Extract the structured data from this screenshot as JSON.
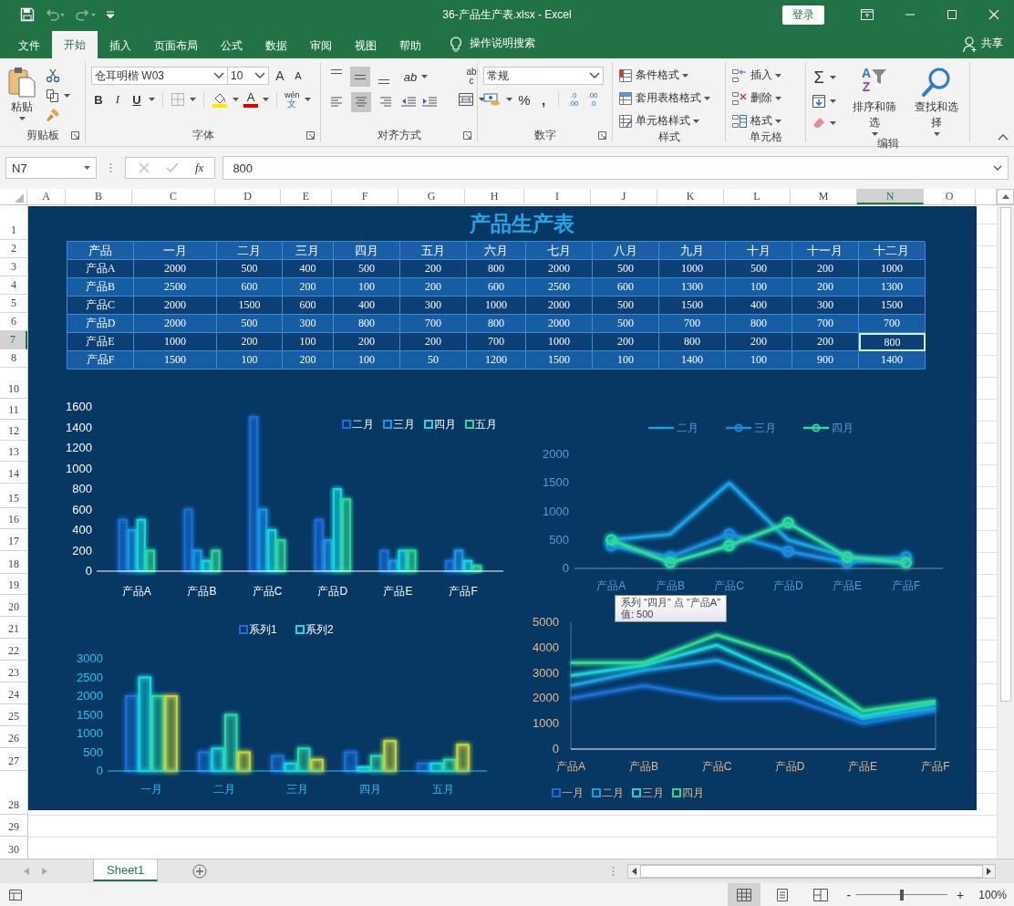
{
  "window": {
    "title": "36-产品生产表.xlsx  -  Excel",
    "sign_in": "登录"
  },
  "ribbon_tabs": [
    {
      "label": "文件",
      "selected": false
    },
    {
      "label": "开始",
      "selected": true
    },
    {
      "label": "插入",
      "selected": false
    },
    {
      "label": "页面布局",
      "selected": false
    },
    {
      "label": "公式",
      "selected": false
    },
    {
      "label": "数据",
      "selected": false
    },
    {
      "label": "审阅",
      "selected": false
    },
    {
      "label": "视图",
      "selected": false
    },
    {
      "label": "帮助",
      "selected": false
    }
  ],
  "tell_me": "操作说明搜索",
  "share": "共享",
  "ribbon": {
    "clipboard": {
      "paste": "粘贴",
      "label": "剪贴板"
    },
    "font": {
      "name": "仓耳明楷 W03",
      "size": "10",
      "grow": "A",
      "shrink": "A",
      "bold": "B",
      "italic": "I",
      "underline": "U",
      "font_color": "A",
      "phonetic": [
        "wén",
        "文"
      ],
      "label": "字体"
    },
    "alignment": {
      "vertical": [
        {
          "kind": "top",
          "selected": false
        },
        {
          "kind": "middle",
          "selected": true
        },
        {
          "kind": "bottom",
          "selected": false
        }
      ],
      "orientation": "ab",
      "wrap": [
        "ab",
        "c"
      ],
      "horizontal": [
        {
          "kind": "left",
          "selected": false
        },
        {
          "kind": "center",
          "selected": true
        },
        {
          "kind": "right",
          "selected": false
        }
      ],
      "label": "对齐方式"
    },
    "number": {
      "format": "常规",
      "percent": "%",
      "comma": ",",
      "increase_decimal": [
        ".0",
        ".00"
      ],
      "decrease_decimal": [
        ".00",
        ".0"
      ],
      "label": "数字"
    },
    "styles": {
      "items": [
        {
          "kind": "conditional",
          "label": "条件格式"
        },
        {
          "kind": "table",
          "label": "套用表格格式"
        },
        {
          "kind": "cell",
          "label": "单元格样式"
        }
      ],
      "label": "样式"
    },
    "cells": {
      "items": [
        {
          "kind": "insert",
          "label": "插入"
        },
        {
          "kind": "delete",
          "label": "删除"
        },
        {
          "kind": "format",
          "label": "格式"
        }
      ],
      "label": "单元格"
    },
    "editing": {
      "sum": "Σ",
      "sort": {
        "label": "排序和筛选",
        "letters": [
          "A",
          "Z"
        ]
      },
      "find": "查找和选择",
      "label": "编辑"
    }
  },
  "formula_bar": {
    "name_box": "N7",
    "fx": "fx",
    "value": "800"
  },
  "columns": [
    {
      "label": "A",
      "selected": false
    },
    {
      "label": "B",
      "selected": false
    },
    {
      "label": "C",
      "selected": false
    },
    {
      "label": "D",
      "selected": false
    },
    {
      "label": "E",
      "selected": false
    },
    {
      "label": "F",
      "selected": false
    },
    {
      "label": "G",
      "selected": false
    },
    {
      "label": "H",
      "selected": false
    },
    {
      "label": "I",
      "selected": false
    },
    {
      "label": "J",
      "selected": false
    },
    {
      "label": "K",
      "selected": false
    },
    {
      "label": "L",
      "selected": false
    },
    {
      "label": "M",
      "selected": false
    },
    {
      "label": "N",
      "selected": true
    },
    {
      "label": "O",
      "selected": false
    }
  ],
  "rows": [
    {
      "label": "1",
      "selected": false
    },
    {
      "label": "2",
      "selected": false
    },
    {
      "label": "3",
      "selected": false
    },
    {
      "label": "4",
      "selected": false
    },
    {
      "label": "5",
      "selected": false
    },
    {
      "label": "6",
      "selected": false
    },
    {
      "label": "7",
      "selected": true
    },
    {
      "label": "8",
      "selected": false
    },
    {
      "label": "10",
      "selected": false
    },
    {
      "label": "11",
      "selected": false
    },
    {
      "label": "12",
      "selected": false
    },
    {
      "label": "13",
      "selected": false
    },
    {
      "label": "14",
      "selected": false
    },
    {
      "label": "15",
      "selected": false
    },
    {
      "label": "16",
      "selected": false
    },
    {
      "label": "17",
      "selected": false
    },
    {
      "label": "18",
      "selected": false
    },
    {
      "label": "19",
      "selected": false
    },
    {
      "label": "20",
      "selected": false
    },
    {
      "label": "21",
      "selected": false
    },
    {
      "label": "22",
      "selected": false
    },
    {
      "label": "23",
      "selected": false
    },
    {
      "label": "24",
      "selected": false
    },
    {
      "label": "25",
      "selected": false
    },
    {
      "label": "26",
      "selected": false
    },
    {
      "label": "27",
      "selected": false
    },
    {
      "label": "28",
      "selected": false
    },
    {
      "label": "29",
      "selected": false
    },
    {
      "label": "30",
      "selected": false
    }
  ],
  "sheet": {
    "title": "产品生产表",
    "table": {
      "header": [
        "产品",
        "一月",
        "二月",
        "三月",
        "四月",
        "五月",
        "六月",
        "七月",
        "八月",
        "九月",
        "十月",
        "十一月",
        "十二月"
      ],
      "rows": [
        {
          "cells": [
            {
              "text": "产品A",
              "selected": false
            },
            {
              "text": "2000",
              "selected": false
            },
            {
              "text": "500",
              "selected": false
            },
            {
              "text": "400",
              "selected": false
            },
            {
              "text": "500",
              "selected": false
            },
            {
              "text": "200",
              "selected": false
            },
            {
              "text": "800",
              "selected": false
            },
            {
              "text": "2000",
              "selected": false
            },
            {
              "text": "500",
              "selected": false
            },
            {
              "text": "1000",
              "selected": false
            },
            {
              "text": "500",
              "selected": false
            },
            {
              "text": "200",
              "selected": false
            },
            {
              "text": "1000",
              "selected": false
            }
          ]
        },
        {
          "cells": [
            {
              "text": "产品B",
              "selected": false
            },
            {
              "text": "2500",
              "selected": false
            },
            {
              "text": "600",
              "selected": false
            },
            {
              "text": "200",
              "selected": false
            },
            {
              "text": "100",
              "selected": false
            },
            {
              "text": "200",
              "selected": false
            },
            {
              "text": "600",
              "selected": false
            },
            {
              "text": "2500",
              "selected": false
            },
            {
              "text": "600",
              "selected": false
            },
            {
              "text": "1300",
              "selected": false
            },
            {
              "text": "100",
              "selected": false
            },
            {
              "text": "200",
              "selected": false
            },
            {
              "text": "1300",
              "selected": false
            }
          ]
        },
        {
          "cells": [
            {
              "text": "产品C",
              "selected": false
            },
            {
              "text": "2000",
              "selected": false
            },
            {
              "text": "1500",
              "selected": false
            },
            {
              "text": "600",
              "selected": false
            },
            {
              "text": "400",
              "selected": false
            },
            {
              "text": "300",
              "selected": false
            },
            {
              "text": "1000",
              "selected": false
            },
            {
              "text": "2000",
              "selected": false
            },
            {
              "text": "500",
              "selected": false
            },
            {
              "text": "1500",
              "selected": false
            },
            {
              "text": "400",
              "selected": false
            },
            {
              "text": "300",
              "selected": false
            },
            {
              "text": "1500",
              "selected": false
            }
          ]
        },
        {
          "cells": [
            {
              "text": "产品D",
              "selected": false
            },
            {
              "text": "2000",
              "selected": false
            },
            {
              "text": "500",
              "selected": false
            },
            {
              "text": "300",
              "selected": false
            },
            {
              "text": "800",
              "selected": false
            },
            {
              "text": "700",
              "selected": false
            },
            {
              "text": "800",
              "selected": false
            },
            {
              "text": "2000",
              "selected": false
            },
            {
              "text": "500",
              "selected": false
            },
            {
              "text": "700",
              "selected": false
            },
            {
              "text": "800",
              "selected": false
            },
            {
              "text": "700",
              "selected": false
            },
            {
              "text": "700",
              "selected": false
            }
          ]
        },
        {
          "cells": [
            {
              "text": "产品E",
              "selected": false
            },
            {
              "text": "1000",
              "selected": false
            },
            {
              "text": "200",
              "selected": false
            },
            {
              "text": "100",
              "selected": false
            },
            {
              "text": "200",
              "selected": false
            },
            {
              "text": "200",
              "selected": false
            },
            {
              "text": "700",
              "selected": false
            },
            {
              "text": "1000",
              "selected": false
            },
            {
              "text": "200",
              "selected": false
            },
            {
              "text": "800",
              "selected": false
            },
            {
              "text": "200",
              "selected": false
            },
            {
              "text": "200",
              "selected": false
            },
            {
              "text": "800",
              "selected": true
            }
          ]
        },
        {
          "cells": [
            {
              "text": "产品F",
              "selected": false
            },
            {
              "text": "1500",
              "selected": false
            },
            {
              "text": "100",
              "selected": false
            },
            {
              "text": "200",
              "selected": false
            },
            {
              "text": "100",
              "selected": false
            },
            {
              "text": "50",
              "selected": false
            },
            {
              "text": "1200",
              "selected": false
            },
            {
              "text": "1500",
              "selected": false
            },
            {
              "text": "100",
              "selected": false
            },
            {
              "text": "1400",
              "selected": false
            },
            {
              "text": "100",
              "selected": false
            },
            {
              "text": "900",
              "selected": false
            },
            {
              "text": "1400",
              "selected": false
            }
          ]
        }
      ]
    },
    "charts": [
      {
        "chart_data": {
          "type": "bar",
          "legend": true,
          "categories": [
            "产品A",
            "产品B",
            "产品C",
            "产品D",
            "产品E",
            "产品F"
          ],
          "ylim": [
            0,
            1600
          ],
          "yticks": [
            0,
            200,
            400,
            600,
            800,
            1000,
            1200,
            1400,
            1600
          ],
          "series": [
            {
              "name": "二月",
              "color": "#1f6fd6",
              "values": [
                500,
                600,
                1500,
                500,
                200,
                100
              ]
            },
            {
              "name": "三月",
              "color": "#1e96e6",
              "values": [
                400,
                200,
                600,
                300,
                100,
                200
              ]
            },
            {
              "name": "四月",
              "color": "#1fd6e0",
              "values": [
                500,
                100,
                400,
                800,
                200,
                100
              ]
            },
            {
              "name": "五月",
              "color": "#2fd69a",
              "values": [
                200,
                200,
                300,
                700,
                200,
                50
              ]
            }
          ]
        }
      },
      {
        "chart_data": {
          "type": "line",
          "legend": true,
          "categories": [
            "产品A",
            "产品B",
            "产品C",
            "产品D",
            "产品E",
            "产品F"
          ],
          "ylim": [
            0,
            2000
          ],
          "yticks": [
            0,
            500,
            1000,
            1500,
            2000
          ],
          "series": [
            {
              "name": "二月",
              "color": "#1ea0e0",
              "values": [
                500,
                600,
                1500,
                500,
                200,
                100
              ]
            },
            {
              "name": "三月",
              "color": "#1e8ee0",
              "marker": "circle",
              "values": [
                400,
                200,
                600,
                300,
                100,
                200
              ]
            },
            {
              "name": "四月",
              "color": "#2ed8a0",
              "marker": "circle",
              "values": [
                500,
                100,
                400,
                800,
                200,
                100
              ]
            }
          ]
        },
        "tooltip": {
          "lines": [
            "系列 \"四月\" 点 \"产品A\"",
            "值: 500"
          ]
        }
      },
      {
        "chart_data": {
          "type": "bar",
          "legend": true,
          "categories": [
            "一月",
            "二月",
            "三月",
            "四月",
            "五月"
          ],
          "ylim": [
            0,
            3000
          ],
          "yticks": [
            0,
            500,
            1000,
            1500,
            2000,
            2500,
            3000
          ],
          "series": [
            {
              "name": "系列1",
              "color": "#1f6fd6",
              "values": [
                2000,
                500,
                400,
                500,
                200
              ]
            },
            {
              "name": "系列2",
              "color": "#1fd6e0",
              "values": [
                2500,
                600,
                200,
                100,
                200
              ]
            },
            {
              "color": "#2fd6a8",
              "values": [
                2000,
                1500,
                600,
                400,
                300
              ]
            },
            {
              "color": "#c8d83c",
              "values": [
                2000,
                500,
                300,
                800,
                700
              ]
            }
          ]
        }
      },
      {
        "chart_data": {
          "type": "line",
          "legend": true,
          "categories": [
            "产品A",
            "产品B",
            "产品C",
            "产品D",
            "产品E",
            "产品F"
          ],
          "ylim": [
            0,
            5000
          ],
          "yticks": [
            0,
            1000,
            2000,
            3000,
            4000,
            5000
          ],
          "series": [
            {
              "name": "一月",
              "color": "#1a6fd0",
              "values": [
                2000,
                2500,
                2000,
                2000,
                1000,
                1500
              ]
            },
            {
              "name": "二月",
              "color": "#1e9ee0",
              "values": [
                2500,
                3100,
                3500,
                2500,
                1200,
                1600
              ]
            },
            {
              "name": "三月",
              "color": "#1fd0d8",
              "values": [
                2900,
                3300,
                4100,
                2800,
                1300,
                1800
              ]
            },
            {
              "name": "四月",
              "color": "#2ed890",
              "values": [
                3400,
                3400,
                4500,
                3600,
                1500,
                1900
              ]
            }
          ]
        }
      }
    ]
  },
  "sheet_tabs": [
    {
      "label": "Sheet1",
      "selected": true
    }
  ],
  "status_bar": {
    "views": [
      {
        "kind": "normal",
        "selected": true
      },
      {
        "kind": "page_layout",
        "selected": false
      },
      {
        "kind": "page_break",
        "selected": false
      }
    ],
    "zoom": {
      "minus": "-",
      "plus": "+",
      "level": 0.5,
      "text": "100%"
    }
  }
}
